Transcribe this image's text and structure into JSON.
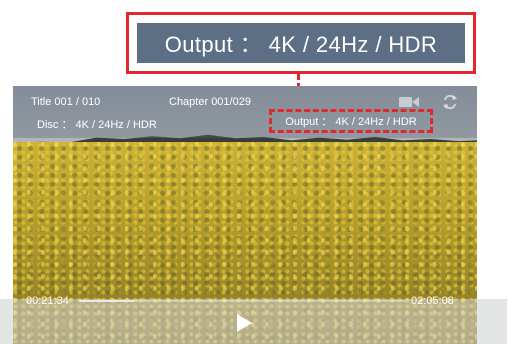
{
  "callout": {
    "text": "Output ： 4K / 24Hz / HDR"
  },
  "hud": {
    "title": "Title  001 / 010",
    "chapter": "Chapter  001/029",
    "disc": "Disc ： 4K / 24Hz / HDR",
    "output": "Output ： 4K / 24Hz / HDR",
    "icons": [
      "camera-icon",
      "repeat-icon"
    ]
  },
  "playback": {
    "elapsed": "00:21:34",
    "total": "02:05:08",
    "progress_fraction": 0.17
  },
  "colors": {
    "highlight": "#e0282f",
    "callout_bg": "#5c6f85"
  }
}
